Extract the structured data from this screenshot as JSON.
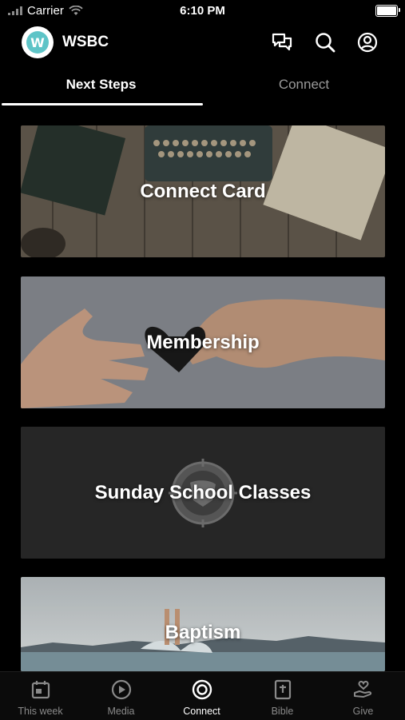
{
  "status_bar": {
    "carrier": "Carrier",
    "time": "6:10 PM"
  },
  "header": {
    "app_name": "WSBC",
    "logo_letter": "W"
  },
  "tabs": [
    {
      "label": "Next Steps",
      "active": true
    },
    {
      "label": "Connect",
      "active": false
    }
  ],
  "cards": [
    {
      "title": "Connect Card"
    },
    {
      "title": "Membership"
    },
    {
      "title": "Sunday School Classes"
    },
    {
      "title": "Baptism"
    }
  ],
  "bottom_nav": [
    {
      "label": "This week",
      "icon": "calendar-icon"
    },
    {
      "label": "Media",
      "icon": "play-icon"
    },
    {
      "label": "Connect",
      "icon": "target-icon",
      "active": true
    },
    {
      "label": "Bible",
      "icon": "bible-icon"
    },
    {
      "label": "Give",
      "icon": "give-heart-icon"
    }
  ],
  "colors": {
    "background": "#000000",
    "accent": "#5ec4c7",
    "inactive": "#8a8a8a"
  }
}
